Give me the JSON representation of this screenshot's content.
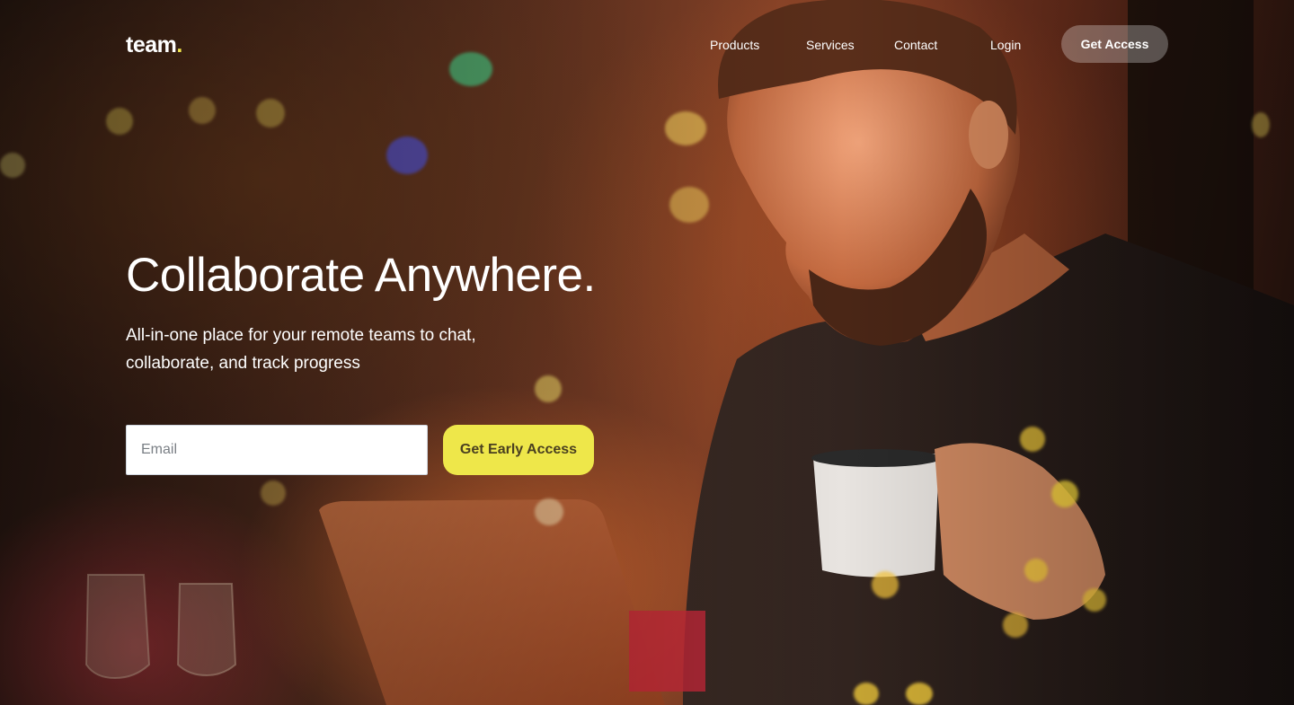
{
  "nav": {
    "logo_text": "team",
    "logo_dot": ".",
    "links": [
      {
        "label": "Products"
      },
      {
        "label": "Services"
      },
      {
        "label": "Contact"
      },
      {
        "label": "Login"
      }
    ],
    "cta_label": "Get Access"
  },
  "hero": {
    "headline": "Collaborate Anywhere.",
    "subhead": "All-in-one place for your remote teams to chat, collaborate, and track progress",
    "email_placeholder": "Email",
    "email_value": "",
    "cta_label": "Get Early Access"
  },
  "colors": {
    "accent_yellow": "#eee74a",
    "logo_dot": "#f2e64a",
    "cta_text": "#4a4020"
  }
}
